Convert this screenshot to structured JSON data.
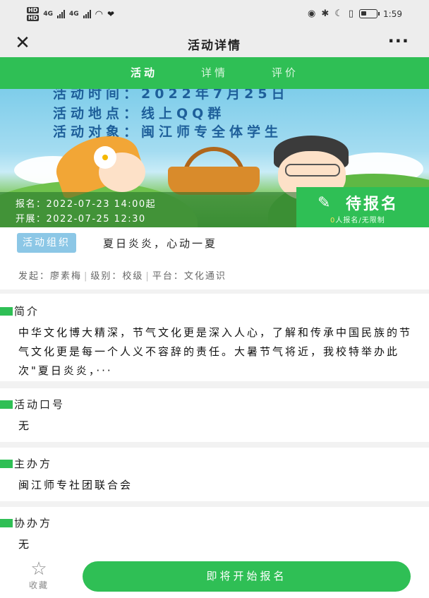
{
  "status_bar": {
    "hd1": "HD",
    "hd2": "HD",
    "sig1": "4G",
    "sig2": "4G",
    "time": "1:59"
  },
  "nav": {
    "title": "活动详情",
    "close_icon": "close-icon",
    "more_icon": "more-icon"
  },
  "tabs": [
    {
      "label": "活动",
      "active": true
    },
    {
      "label": "详情",
      "active": false
    },
    {
      "label": "评价",
      "active": false
    }
  ],
  "banner": {
    "line1": "活动时间：2022年7月25日",
    "line2": "活动地点：线上QQ群",
    "line3": "活动对象：闽江师专全体学生"
  },
  "info": {
    "signup_time": "报名：2022-07-23 14:00起",
    "start_time": "开展：2022-07-25 12:30"
  },
  "status": {
    "label": "待报名",
    "count": "0",
    "sub": "人报名/无限制",
    "edit_icon": "pencil-icon"
  },
  "activity": {
    "tag": "活动组织",
    "name": "夏日炎炎，心动一夏",
    "initiator": "发起：廖素梅",
    "level": "级别：校级",
    "platform": "平台：文化通识"
  },
  "sections": {
    "intro_title": "简介",
    "intro_text": "中华文化博大精深，节气文化更是深入人心，了解和传承中国民族的节气文化更是每一个人义不容辞的责任。大暑节气将近，我校特举办此次\"夏日炎炎，···",
    "slogan_title": "活动口号",
    "slogan_value": "无",
    "host_title": "主办方",
    "host_value": "闽江师专社团联合会",
    "co_title": "协办方",
    "co_value": "无"
  },
  "bottom": {
    "fav_label": "收藏",
    "fav_icon": "star-icon",
    "signup_label": "即将开始报名"
  },
  "colors": {
    "accent": "#2fbf55",
    "tag_bg": "#8cc7e6",
    "banner_text": "#1e5f9a"
  }
}
